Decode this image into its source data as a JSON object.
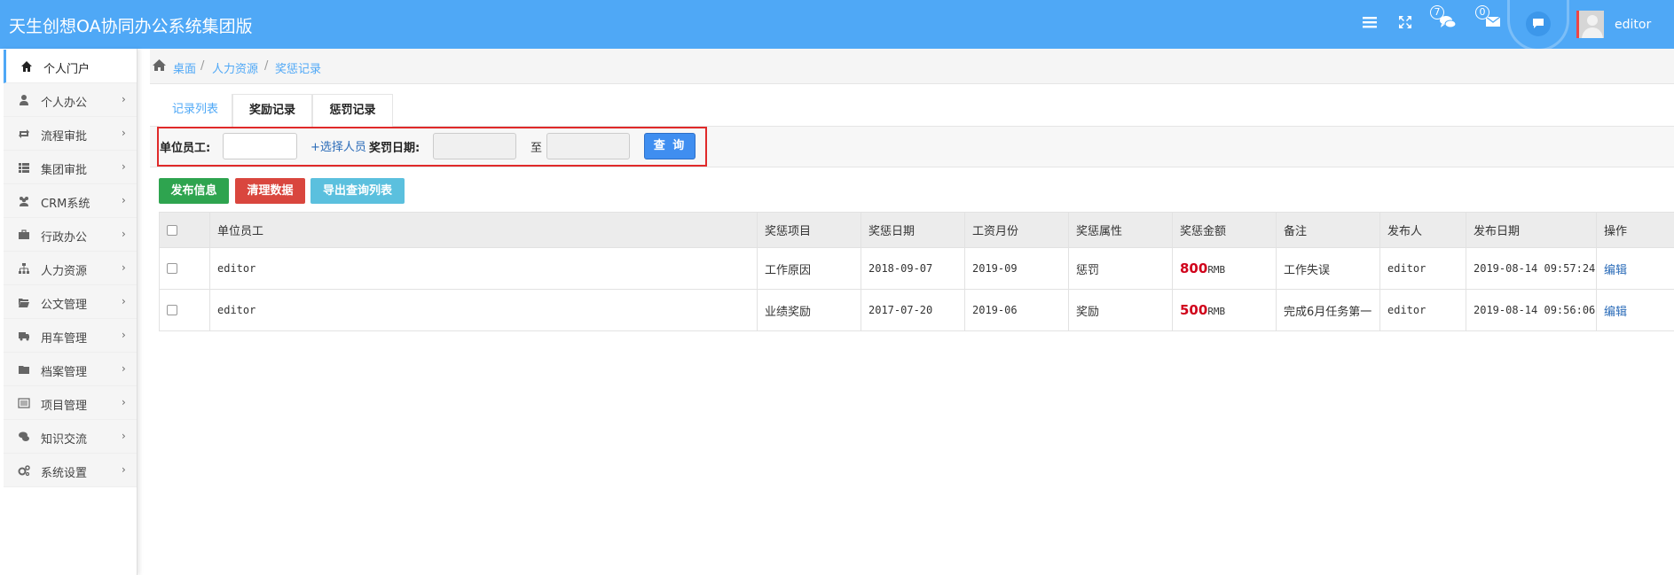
{
  "header": {
    "title": "天生创想OA协同办公系统集团版",
    "messages_count": "7",
    "mail_count": "0",
    "username": "editor"
  },
  "sidebar": {
    "items": [
      {
        "label": "个人门户",
        "icon": "home-icon"
      },
      {
        "label": "个人办公",
        "icon": "user-icon"
      },
      {
        "label": "流程审批",
        "icon": "retweet-icon"
      },
      {
        "label": "集团审批",
        "icon": "list-icon"
      },
      {
        "label": "CRM系统",
        "icon": "users-icon"
      },
      {
        "label": "行政办公",
        "icon": "briefcase-icon"
      },
      {
        "label": "人力资源",
        "icon": "sitemap-icon"
      },
      {
        "label": "公文管理",
        "icon": "folder-open-icon"
      },
      {
        "label": "用车管理",
        "icon": "truck-icon"
      },
      {
        "label": "档案管理",
        "icon": "folder-icon"
      },
      {
        "label": "项目管理",
        "icon": "list-alt-icon"
      },
      {
        "label": "知识交流",
        "icon": "comments-icon"
      },
      {
        "label": "系统设置",
        "icon": "cogs-icon"
      }
    ]
  },
  "breadcrumb": [
    "桌面",
    "人力资源",
    "奖惩记录"
  ],
  "tabs": [
    "记录列表",
    "奖励记录",
    "惩罚记录"
  ],
  "filter": {
    "employee_label": "单位员工:",
    "employee_value": "",
    "select_person": "+选择人员",
    "date_label": "奖罚日期:",
    "date_from": "",
    "to_label": "至",
    "date_to": "",
    "query_button": "查 询"
  },
  "actions": {
    "publish": "发布信息",
    "clear": "清理数据",
    "export": "导出查询列表"
  },
  "table": {
    "headers": [
      "单位员工",
      "奖惩项目",
      "奖惩日期",
      "工资月份",
      "奖惩属性",
      "奖惩金额",
      "备注",
      "发布人",
      "发布日期",
      "操作"
    ],
    "rows": [
      {
        "employee": "editor",
        "item": "工作原因",
        "date": "2018-09-07",
        "salary_month": "2019-09",
        "attr": "惩罚",
        "amount": "800",
        "unit": "RMB",
        "note": "工作失误",
        "publisher": "editor",
        "publish_date": "2019-08-14 09:57:24",
        "op": "编辑"
      },
      {
        "employee": "editor",
        "item": "业绩奖励",
        "date": "2017-07-20",
        "salary_month": "2019-06",
        "attr": "奖励",
        "amount": "500",
        "unit": "RMB",
        "note": "完成6月任务第一",
        "publisher": "editor",
        "publish_date": "2019-08-14 09:56:06",
        "op": "编辑"
      }
    ]
  },
  "colors": {
    "header_bg": "#4fa8f6",
    "penalty": "#333333",
    "reward": "#2e8b2e",
    "amount": "#d0021b"
  }
}
